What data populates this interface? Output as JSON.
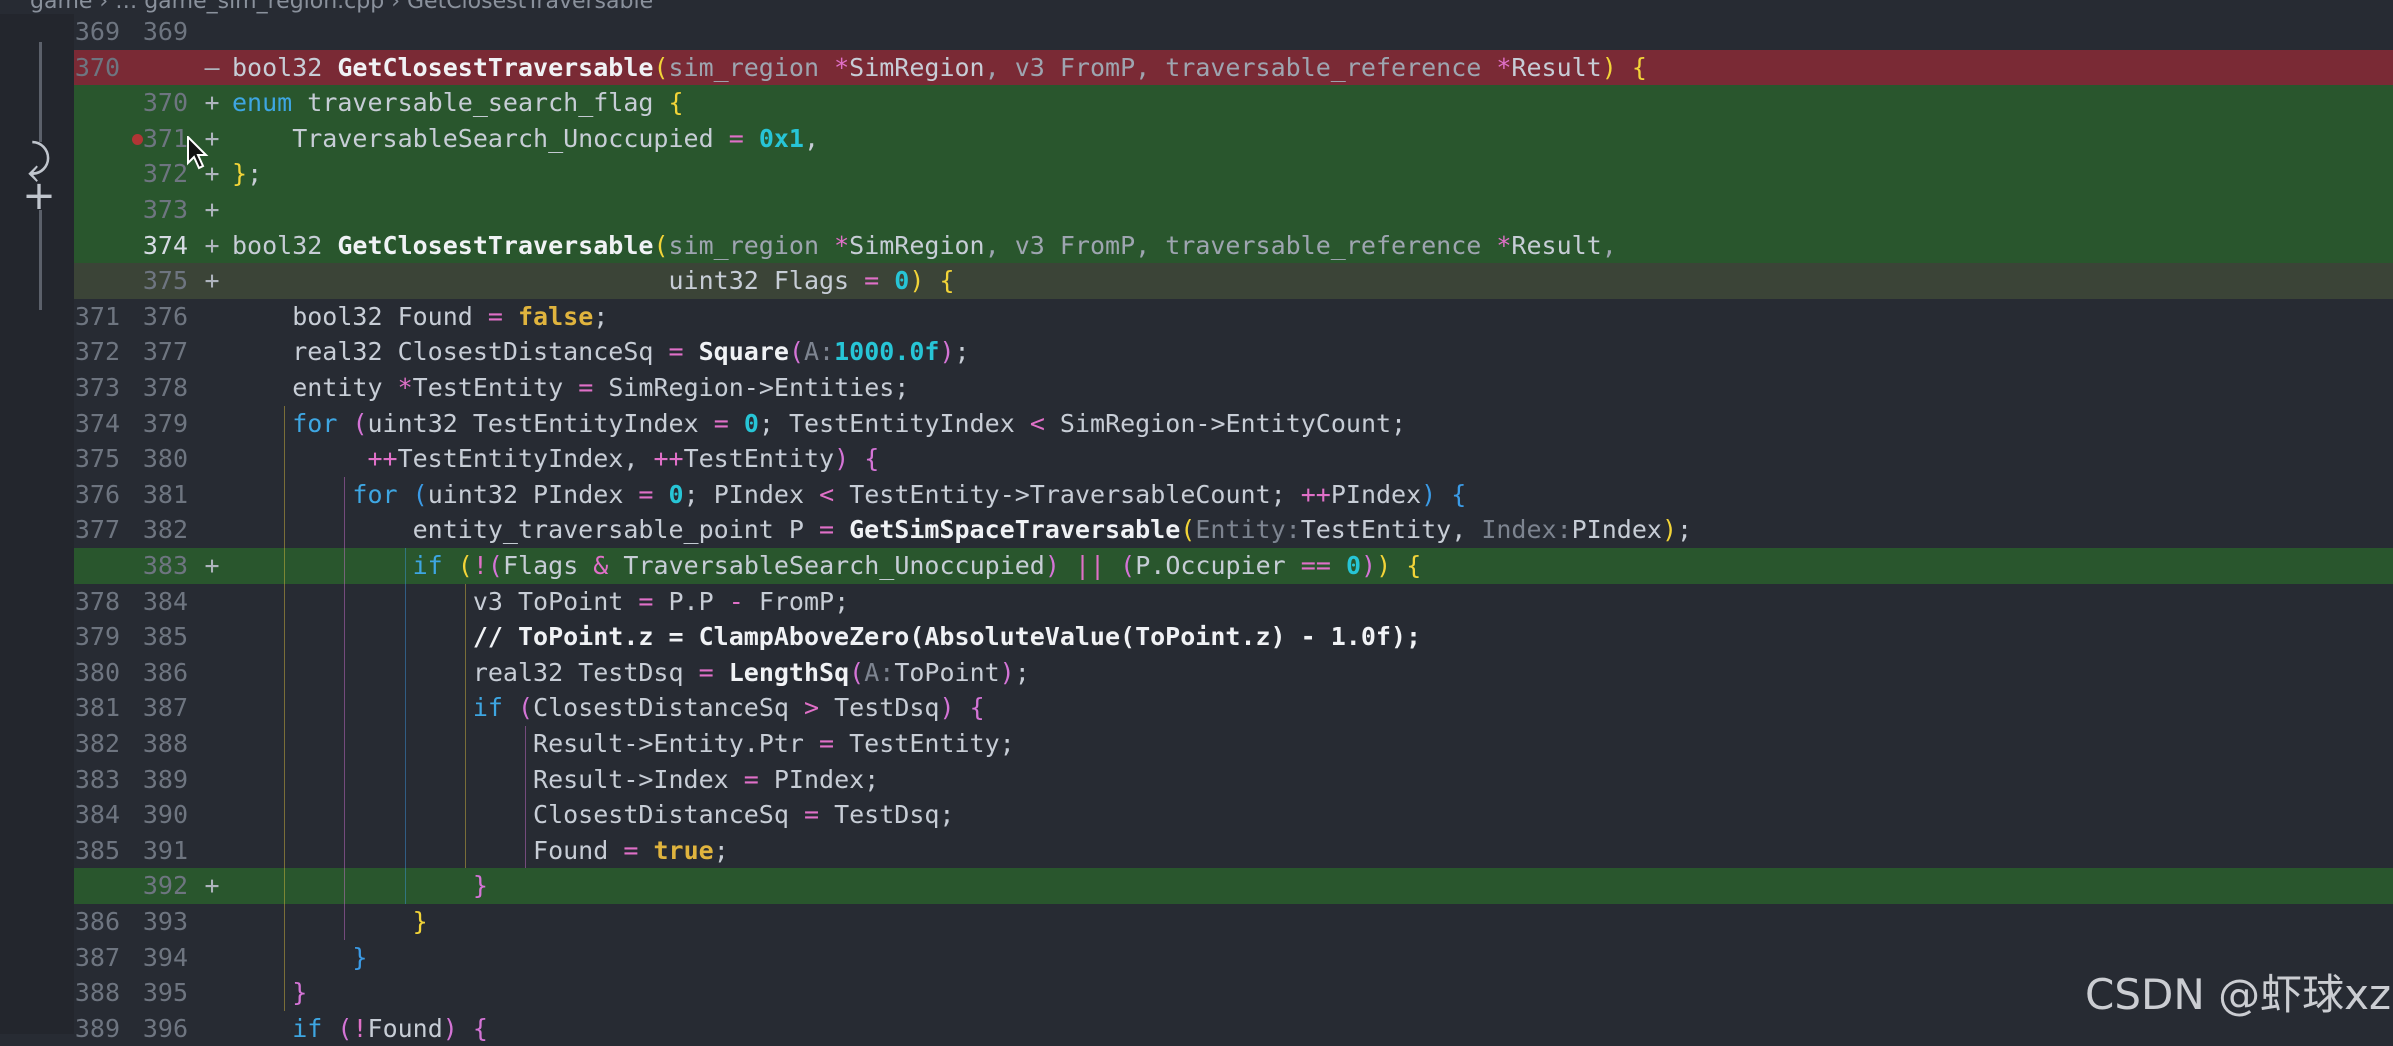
{
  "breadcrumb": "game › … game_sim_region.cpp › GetClosestTraversable",
  "gutter_icons": {
    "revert": "⤸",
    "add": "+"
  },
  "watermark": "CSDN @虾球xz",
  "lines": [
    {
      "old": "369",
      "new": "369",
      "mark": "",
      "state": "",
      "code": []
    },
    {
      "old": "370",
      "new": "",
      "mark": "—",
      "state": "del",
      "code": [
        [
          "t",
          "bool32 "
        ],
        [
          "fn",
          "GetClosestTraversable"
        ],
        [
          "b1",
          "("
        ],
        [
          "param",
          "sim_region "
        ],
        [
          "op",
          "*"
        ],
        [
          "t",
          "SimRegion"
        ],
        [
          "param",
          ", v3 FromP, traversable_reference "
        ],
        [
          "op",
          "*"
        ],
        [
          "t",
          "Result"
        ],
        [
          "b1",
          ")"
        ],
        [
          "t",
          " "
        ],
        [
          "b1",
          "{"
        ]
      ]
    },
    {
      "old": "",
      "new": "370",
      "mark": "+",
      "state": "add",
      "code": [
        [
          "k",
          "enum"
        ],
        [
          "t",
          " traversable_search_flag "
        ],
        [
          "b1",
          "{"
        ]
      ]
    },
    {
      "old": "",
      "new": "371",
      "mark": "+",
      "state": "add",
      "bp": true,
      "code": [
        [
          "t",
          "    TraversableSearch_Unoccupied "
        ],
        [
          "op",
          "="
        ],
        [
          "t",
          " "
        ],
        [
          "num",
          "0x1"
        ],
        [
          "t",
          ","
        ]
      ]
    },
    {
      "old": "",
      "new": "372",
      "mark": "+",
      "state": "add",
      "code": [
        [
          "b1",
          "}"
        ],
        [
          "t",
          ";"
        ]
      ]
    },
    {
      "old": "",
      "new": "373",
      "mark": "+",
      "state": "add",
      "code": []
    },
    {
      "old": "",
      "new": "374",
      "mark": "+",
      "state": "add",
      "cur": true,
      "code": [
        [
          "t",
          "bool32 "
        ],
        [
          "fn",
          "GetClosestTraversable"
        ],
        [
          "b1",
          "("
        ],
        [
          "param",
          "sim_region "
        ],
        [
          "op",
          "*"
        ],
        [
          "t",
          "SimRegion"
        ],
        [
          "param",
          ", v3 FromP, traversable_reference "
        ],
        [
          "op",
          "*"
        ],
        [
          "t",
          "Result"
        ],
        [
          "param",
          ","
        ]
      ]
    },
    {
      "old": "",
      "new": "375",
      "mark": "+",
      "state": "mod",
      "code": [
        [
          "t",
          "                             uint32 Flags "
        ],
        [
          "op",
          "="
        ],
        [
          "t",
          " "
        ],
        [
          "num",
          "0"
        ],
        [
          "b1",
          ")"
        ],
        [
          "t",
          " "
        ],
        [
          "b1",
          "{"
        ]
      ]
    },
    {
      "old": "371",
      "new": "376",
      "mark": "",
      "state": "",
      "code": [
        [
          "t",
          "    bool32 Found "
        ],
        [
          "op",
          "="
        ],
        [
          "t",
          " "
        ],
        [
          "bool",
          "false"
        ],
        [
          "t",
          ";"
        ]
      ]
    },
    {
      "old": "372",
      "new": "377",
      "mark": "",
      "state": "",
      "code": [
        [
          "t",
          "    real32 ClosestDistanceSq "
        ],
        [
          "op",
          "="
        ],
        [
          "t",
          " "
        ],
        [
          "fn",
          "Square"
        ],
        [
          "b2",
          "("
        ],
        [
          "hint",
          "A:"
        ],
        [
          "num",
          "1000.0f"
        ],
        [
          "b2",
          ")"
        ],
        [
          "t",
          ";"
        ]
      ]
    },
    {
      "old": "373",
      "new": "378",
      "mark": "",
      "state": "",
      "code": [
        [
          "t",
          "    entity "
        ],
        [
          "op",
          "*"
        ],
        [
          "t",
          "TestEntity "
        ],
        [
          "op",
          "="
        ],
        [
          "t",
          " SimRegion->Entities;"
        ]
      ]
    },
    {
      "old": "374",
      "new": "379",
      "mark": "",
      "state": "",
      "code": [
        [
          "t",
          "    "
        ],
        [
          "k",
          "for"
        ],
        [
          "t",
          " "
        ],
        [
          "b2",
          "("
        ],
        [
          "t",
          "uint32 TestEntityIndex "
        ],
        [
          "op",
          "="
        ],
        [
          "t",
          " "
        ],
        [
          "num",
          "0"
        ],
        [
          "t",
          "; TestEntityIndex "
        ],
        [
          "op",
          "<"
        ],
        [
          "t",
          " SimRegion->EntityCount;"
        ]
      ]
    },
    {
      "old": "375",
      "new": "380",
      "mark": "",
      "state": "",
      "code": [
        [
          "t",
          "         "
        ],
        [
          "op",
          "++"
        ],
        [
          "t",
          "TestEntityIndex, "
        ],
        [
          "op",
          "++"
        ],
        [
          "t",
          "TestEntity"
        ],
        [
          "b2",
          ")"
        ],
        [
          "t",
          " "
        ],
        [
          "b2",
          "{"
        ]
      ]
    },
    {
      "old": "376",
      "new": "381",
      "mark": "",
      "state": "",
      "code": [
        [
          "t",
          "        "
        ],
        [
          "k",
          "for"
        ],
        [
          "t",
          " "
        ],
        [
          "b3",
          "("
        ],
        [
          "t",
          "uint32 PIndex "
        ],
        [
          "op",
          "="
        ],
        [
          "t",
          " "
        ],
        [
          "num",
          "0"
        ],
        [
          "t",
          "; PIndex "
        ],
        [
          "op",
          "<"
        ],
        [
          "t",
          " TestEntity->TraversableCount; "
        ],
        [
          "op",
          "++"
        ],
        [
          "t",
          "PIndex"
        ],
        [
          "b3",
          ")"
        ],
        [
          "t",
          " "
        ],
        [
          "b3",
          "{"
        ]
      ]
    },
    {
      "old": "377",
      "new": "382",
      "mark": "",
      "state": "",
      "code": [
        [
          "t",
          "            entity_traversable_point P "
        ],
        [
          "op",
          "="
        ],
        [
          "t",
          " "
        ],
        [
          "fn",
          "GetSimSpaceTraversable"
        ],
        [
          "b1",
          "("
        ],
        [
          "hint",
          "Entity:"
        ],
        [
          "t",
          "TestEntity, "
        ],
        [
          "hint",
          "Index:"
        ],
        [
          "t",
          "PIndex"
        ],
        [
          "b1",
          ")"
        ],
        [
          "t",
          ";"
        ]
      ]
    },
    {
      "old": "",
      "new": "383",
      "mark": "+",
      "state": "add",
      "code": [
        [
          "t",
          "            "
        ],
        [
          "k",
          "if"
        ],
        [
          "t",
          " "
        ],
        [
          "b1",
          "("
        ],
        [
          "op",
          "!"
        ],
        [
          "b2",
          "("
        ],
        [
          "t",
          "Flags "
        ],
        [
          "op",
          "&"
        ],
        [
          "t",
          " TraversableSearch_Unoccupied"
        ],
        [
          "b2",
          ")"
        ],
        [
          "t",
          " "
        ],
        [
          "op",
          "||"
        ],
        [
          "t",
          " "
        ],
        [
          "b2",
          "("
        ],
        [
          "t",
          "P.Occupier "
        ],
        [
          "op",
          "=="
        ],
        [
          "t",
          " "
        ],
        [
          "num",
          "0"
        ],
        [
          "b2",
          ")"
        ],
        [
          "b1",
          ")"
        ],
        [
          "t",
          " "
        ],
        [
          "b1",
          "{"
        ]
      ]
    },
    {
      "old": "378",
      "new": "384",
      "mark": "",
      "state": "",
      "code": [
        [
          "t",
          "                v3 ToPoint "
        ],
        [
          "op",
          "="
        ],
        [
          "t",
          " P.P "
        ],
        [
          "op",
          "-"
        ],
        [
          "t",
          " FromP;"
        ]
      ]
    },
    {
      "old": "379",
      "new": "385",
      "mark": "",
      "state": "",
      "code": [
        [
          "t",
          "                "
        ],
        [
          "cm",
          "// ToPoint.z = ClampAboveZero(AbsoluteValue(ToPoint.z) - 1.0f);"
        ]
      ]
    },
    {
      "old": "380",
      "new": "386",
      "mark": "",
      "state": "",
      "code": [
        [
          "t",
          "                real32 TestDsq "
        ],
        [
          "op",
          "="
        ],
        [
          "t",
          " "
        ],
        [
          "fn",
          "LengthSq"
        ],
        [
          "b2",
          "("
        ],
        [
          "hint",
          "A:"
        ],
        [
          "t",
          "ToPoint"
        ],
        [
          "b2",
          ")"
        ],
        [
          "t",
          ";"
        ]
      ]
    },
    {
      "old": "381",
      "new": "387",
      "mark": "",
      "state": "",
      "code": [
        [
          "t",
          "                "
        ],
        [
          "k",
          "if"
        ],
        [
          "t",
          " "
        ],
        [
          "b2",
          "("
        ],
        [
          "t",
          "ClosestDistanceSq "
        ],
        [
          "op",
          ">"
        ],
        [
          "t",
          " TestDsq"
        ],
        [
          "b2",
          ")"
        ],
        [
          "t",
          " "
        ],
        [
          "b2",
          "{"
        ]
      ]
    },
    {
      "old": "382",
      "new": "388",
      "mark": "",
      "state": "",
      "code": [
        [
          "t",
          "                    Result->Entity.Ptr "
        ],
        [
          "op",
          "="
        ],
        [
          "t",
          " TestEntity;"
        ]
      ]
    },
    {
      "old": "383",
      "new": "389",
      "mark": "",
      "state": "",
      "code": [
        [
          "t",
          "                    Result->Index "
        ],
        [
          "op",
          "="
        ],
        [
          "t",
          " PIndex;"
        ]
      ]
    },
    {
      "old": "384",
      "new": "390",
      "mark": "",
      "state": "",
      "code": [
        [
          "t",
          "                    ClosestDistanceSq "
        ],
        [
          "op",
          "="
        ],
        [
          "t",
          " TestDsq;"
        ]
      ]
    },
    {
      "old": "385",
      "new": "391",
      "mark": "",
      "state": "",
      "code": [
        [
          "t",
          "                    Found "
        ],
        [
          "op",
          "="
        ],
        [
          "t",
          " "
        ],
        [
          "bool",
          "true"
        ],
        [
          "t",
          ";"
        ]
      ]
    },
    {
      "old": "",
      "new": "392",
      "mark": "+",
      "state": "add",
      "code": [
        [
          "t",
          "                "
        ],
        [
          "b2",
          "}"
        ]
      ]
    },
    {
      "old": "386",
      "new": "393",
      "mark": "",
      "state": "",
      "code": [
        [
          "t",
          "            "
        ],
        [
          "b1",
          "}"
        ]
      ]
    },
    {
      "old": "387",
      "new": "394",
      "mark": "",
      "state": "",
      "code": [
        [
          "t",
          "        "
        ],
        [
          "b3",
          "}"
        ]
      ]
    },
    {
      "old": "388",
      "new": "395",
      "mark": "",
      "state": "",
      "code": [
        [
          "t",
          "    "
        ],
        [
          "b2",
          "}"
        ]
      ]
    },
    {
      "old": "389",
      "new": "396",
      "mark": "",
      "state": "",
      "code": [
        [
          "t",
          "    "
        ],
        [
          "k",
          "if"
        ],
        [
          "t",
          " "
        ],
        [
          "b2",
          "("
        ],
        [
          "op",
          "!"
        ],
        [
          "t",
          "Found"
        ],
        [
          "b2",
          ")"
        ],
        [
          "t",
          " "
        ],
        [
          "b2",
          "{"
        ]
      ]
    }
  ]
}
